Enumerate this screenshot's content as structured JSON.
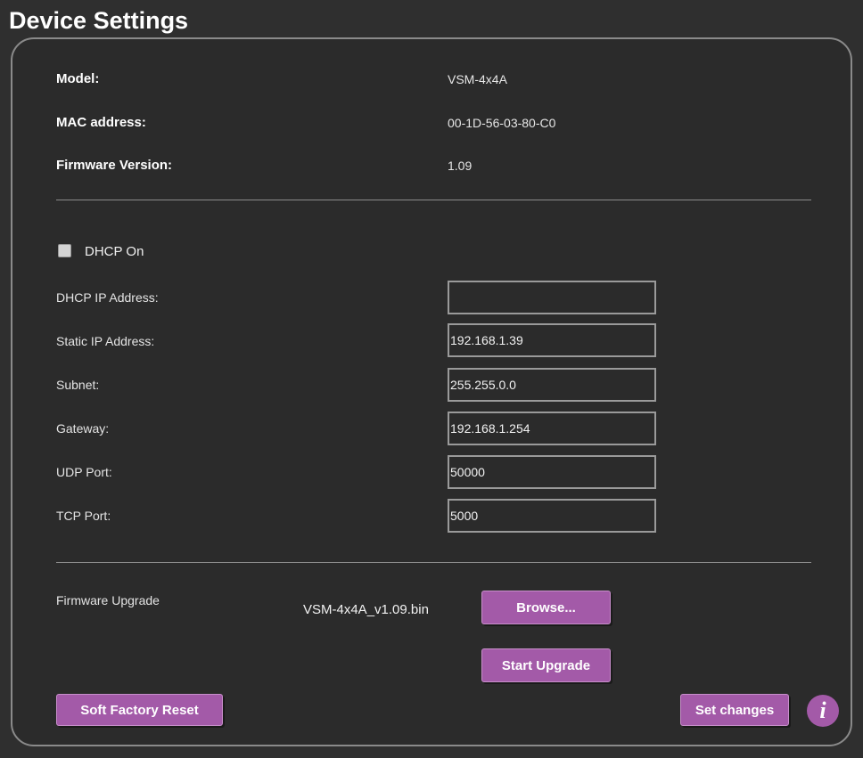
{
  "page": {
    "title": "Device Settings"
  },
  "device_info": {
    "model_label": "Model:",
    "model_value": "VSM-4x4A",
    "mac_label": "MAC address:",
    "mac_value": "00-1D-56-03-80-C0",
    "firmware_label": "Firmware Version:",
    "firmware_value": "1.09"
  },
  "network": {
    "dhcp_label": "DHCP On",
    "dhcp_checked": false,
    "fields": [
      {
        "label": "DHCP IP Address:",
        "value": ""
      },
      {
        "label": "Static IP Address:",
        "value": "192.168.1.39"
      },
      {
        "label": "Subnet:",
        "value": "255.255.0.0"
      },
      {
        "label": "Gateway:",
        "value": "192.168.1.254"
      },
      {
        "label": "UDP Port:",
        "value": "50000"
      },
      {
        "label": "TCP Port:",
        "value": "5000"
      }
    ]
  },
  "firmware_upgrade": {
    "label": "Firmware Upgrade",
    "filename": "VSM-4x4A_v1.09.bin",
    "browse_label": "Browse...",
    "start_label": "Start Upgrade"
  },
  "actions": {
    "soft_reset_label": "Soft Factory Reset",
    "set_changes_label": "Set changes",
    "info_icon_glyph": "i"
  },
  "colors": {
    "background": "#2f2f2f",
    "accent_button": "#a35aa8",
    "panel_border": "#8a8a8a"
  },
  "icons": {
    "info": "info-icon",
    "checkbox": "checkbox-unchecked-icon"
  }
}
